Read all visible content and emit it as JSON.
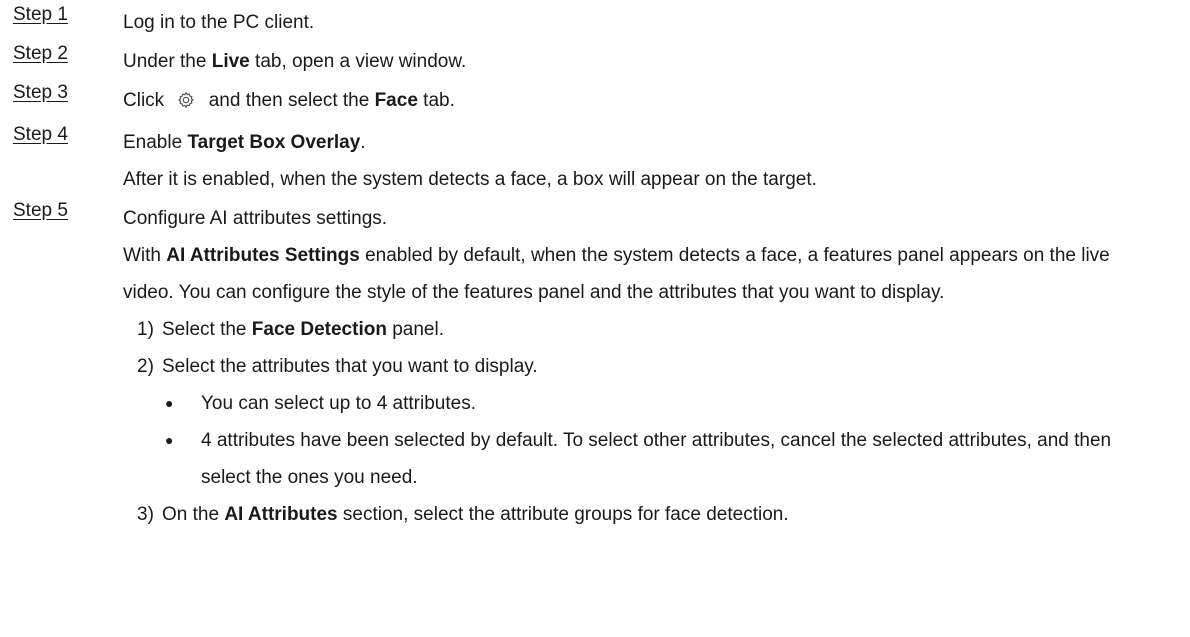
{
  "steps": [
    {
      "label": "Step 1",
      "text": "Log in to the PC client."
    },
    {
      "label": "Step 2",
      "pre": "Under the ",
      "bold": "Live",
      "post": " tab, open a view window."
    },
    {
      "label": "Step 3",
      "pre": "Click ",
      "icon": "gear-icon",
      "mid": " and then select the ",
      "bold": "Face",
      "post": " tab."
    },
    {
      "label": "Step 4",
      "pre": "Enable ",
      "bold": "Target Box Overlay",
      "post": ".",
      "note": "After it is enabled, when the system detects a face, a box will appear on the target."
    },
    {
      "label": "Step 5",
      "text": "Configure AI attributes settings.",
      "para_pre": "With ",
      "para_bold": "AI Attributes Settings",
      "para_post": " enabled by default, when the system detects a face, a features panel appears on the live video. You can configure the style of the features panel and the attributes that you want to display.",
      "substeps": [
        {
          "num": "1)",
          "pre": "Select the ",
          "bold": "Face Detection",
          "post": " panel."
        },
        {
          "num": "2)",
          "text": "Select the attributes that you want to display.",
          "bullets": [
            "You can select up to 4 attributes.",
            "4 attributes have been selected by default. To select other attributes, cancel the selected attributes, and then select the ones you need."
          ]
        },
        {
          "num": "3)",
          "pre": "On the ",
          "bold": "AI Attributes",
          "post": " section, select the attribute groups for face detection."
        }
      ]
    }
  ],
  "bullet_glyph": "●"
}
